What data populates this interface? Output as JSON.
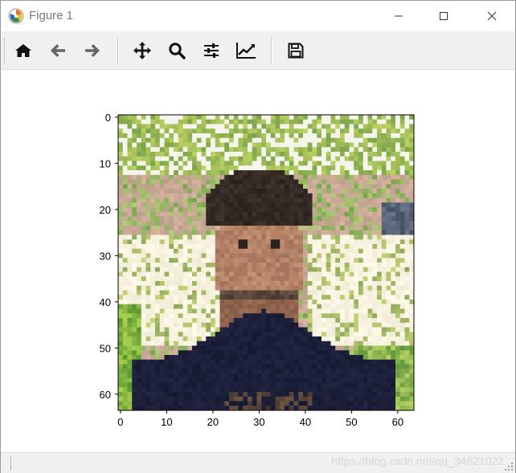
{
  "window": {
    "title": "Figure 1"
  },
  "title_buttons": [
    "minimize",
    "maximize",
    "close"
  ],
  "toolbar": {
    "buttons": [
      {
        "name": "home",
        "icon": "home-icon"
      },
      {
        "name": "back",
        "icon": "arrow-left-icon"
      },
      {
        "name": "forward",
        "icon": "arrow-right-icon"
      },
      {
        "name": "pan",
        "icon": "move-icon"
      },
      {
        "name": "zoom",
        "icon": "magnifier-icon"
      },
      {
        "name": "subplots",
        "icon": "sliders-icon"
      },
      {
        "name": "edit-axes",
        "icon": "line-chart-icon"
      },
      {
        "name": "save",
        "icon": "floppy-disk-icon"
      }
    ]
  },
  "plot": {
    "x_ticks": [
      "0",
      "10",
      "20",
      "30",
      "40",
      "50",
      "60"
    ],
    "y_ticks": [
      "0",
      "10",
      "20",
      "30",
      "40",
      "50",
      "60"
    ],
    "image_size": 64
  },
  "status": {
    "watermark": "https://blog.csdn.net/qq_34621022"
  },
  "colors": {
    "toolbar_bg": "#f0f0f0",
    "title_text": "#7a7a7a"
  }
}
